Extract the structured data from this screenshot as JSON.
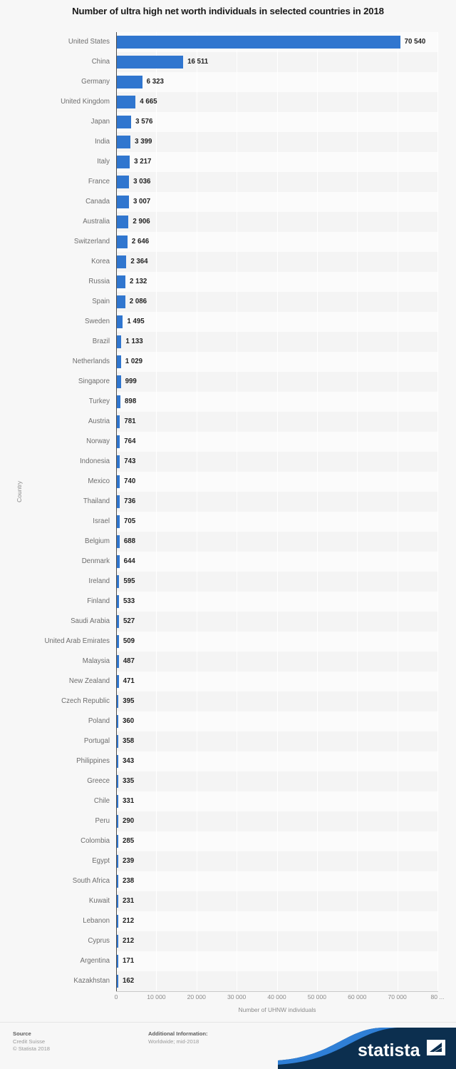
{
  "title": "Number of ultra high net worth individuals in selected countries in 2018",
  "axes": {
    "ylabel": "Country",
    "xlabel": "Number of UHNW individuals",
    "xticks": [
      "0",
      "10 000",
      "20 000",
      "30 000",
      "40 000",
      "50 000",
      "60 000",
      "70 000",
      "80 ..."
    ]
  },
  "footer": {
    "source_heading": "Source",
    "source_name": "Credit Suisse",
    "copyright": "© Statista 2018",
    "additional_heading": "Additional Information:",
    "additional_text": "Worldwide; mid-2018",
    "logo_text": "statista"
  },
  "colors": {
    "bar": "#3076cf",
    "logo_dark": "#0c2f4f",
    "logo_accent": "#2f7fd6",
    "plot_band_a": "#fbfbfb",
    "plot_band_b": "#f4f4f4"
  },
  "chart_data": {
    "type": "bar",
    "orientation": "horizontal",
    "title": "Number of ultra high net worth individuals in selected countries in 2018",
    "xlabel": "Number of UHNW individuals",
    "ylabel": "Country",
    "xlim": [
      0,
      80000
    ],
    "xticks": [
      0,
      10000,
      20000,
      30000,
      40000,
      50000,
      60000,
      70000,
      80000
    ],
    "grid": "vertical",
    "legend": "none",
    "categories": [
      "United States",
      "China",
      "Germany",
      "United Kingdom",
      "Japan",
      "India",
      "Italy",
      "France",
      "Canada",
      "Australia",
      "Switzerland",
      "Korea",
      "Russia",
      "Spain",
      "Sweden",
      "Brazil",
      "Netherlands",
      "Singapore",
      "Turkey",
      "Austria",
      "Norway",
      "Indonesia",
      "Mexico",
      "Thailand",
      "Israel",
      "Belgium",
      "Denmark",
      "Ireland",
      "Finland",
      "Saudi Arabia",
      "United Arab Emirates",
      "Malaysia",
      "New Zealand",
      "Czech Republic",
      "Poland",
      "Portugal",
      "Philippines",
      "Greece",
      "Chile",
      "Peru",
      "Colombia",
      "Egypt",
      "South Africa",
      "Kuwait",
      "Lebanon",
      "Cyprus",
      "Argentina",
      "Kazakhstan"
    ],
    "values": [
      70540,
      16511,
      6323,
      4665,
      3576,
      3399,
      3217,
      3036,
      3007,
      2906,
      2646,
      2364,
      2132,
      2086,
      1495,
      1133,
      1029,
      999,
      898,
      781,
      764,
      743,
      740,
      736,
      705,
      688,
      644,
      595,
      533,
      527,
      509,
      487,
      471,
      395,
      360,
      358,
      343,
      335,
      331,
      290,
      285,
      239,
      238,
      231,
      212,
      212,
      171,
      162
    ],
    "value_labels": [
      "70 540",
      "16 511",
      "6 323",
      "4 665",
      "3 576",
      "3 399",
      "3 217",
      "3 036",
      "3 007",
      "2 906",
      "2 646",
      "2 364",
      "2 132",
      "2 086",
      "1 495",
      "1 133",
      "1 029",
      "999",
      "898",
      "781",
      "764",
      "743",
      "740",
      "736",
      "705",
      "688",
      "644",
      "595",
      "533",
      "527",
      "509",
      "487",
      "471",
      "395",
      "360",
      "358",
      "343",
      "335",
      "331",
      "290",
      "285",
      "239",
      "238",
      "231",
      "212",
      "212",
      "171",
      "162"
    ]
  }
}
